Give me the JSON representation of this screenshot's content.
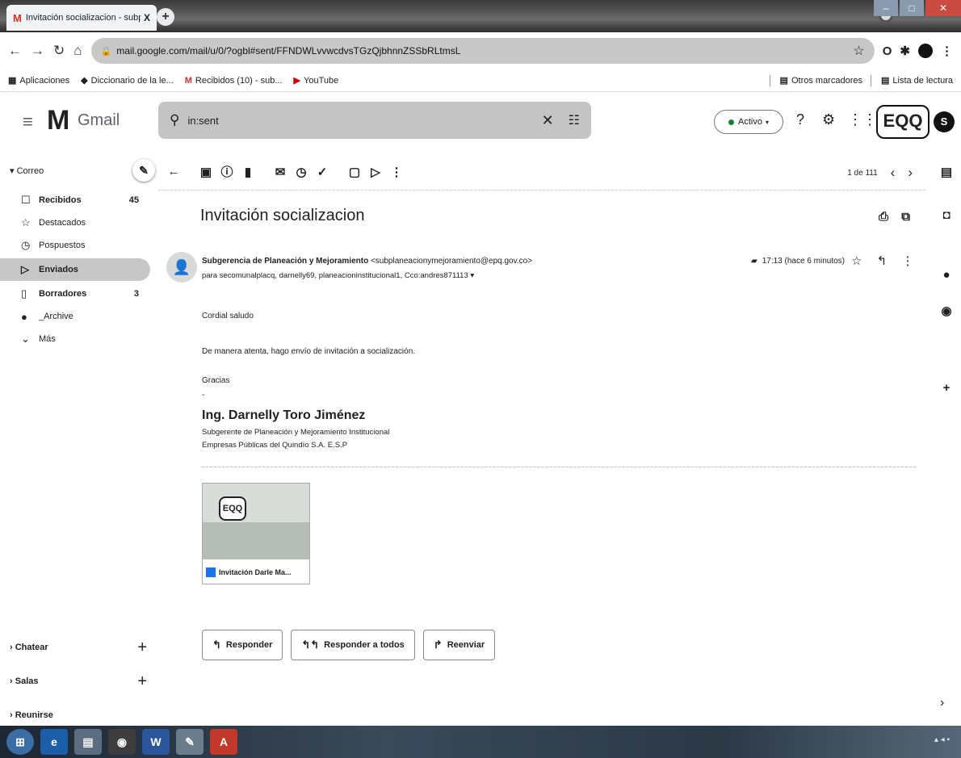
{
  "browser": {
    "tab_title": "Invitación socializacion - subplan",
    "tab_close": "X",
    "new_tab": "+",
    "url": "mail.google.com/mail/u/0/?ogbl#sent/FFNDWLvvwcdvsTGzQjbhnnZSSbRLtmsL",
    "bookmarks": [
      "Aplicaciones",
      "Diccionario de la le...",
      "Recibidos (10) - sub...",
      "YouTube"
    ],
    "bookmarks_right": [
      "Otros marcadores",
      "Lista de lectura"
    ]
  },
  "header": {
    "app_name": "Gmail",
    "search_value": "in:sent",
    "status": "Activo",
    "brand_badge": "EQQ",
    "avatar_letter": "S"
  },
  "sidebar": {
    "section_label": "Correo",
    "items": [
      {
        "icon": "inbox-icon",
        "glyph": "☐",
        "label": "Recibidos",
        "count": "45",
        "bold": true
      },
      {
        "icon": "star-icon",
        "glyph": "☆",
        "label": "Destacados",
        "count": "",
        "bold": false
      },
      {
        "icon": "clock-icon",
        "glyph": "◷",
        "label": "Pospuestos",
        "count": "",
        "bold": false
      },
      {
        "icon": "send-icon",
        "glyph": "▷",
        "label": "Enviados",
        "count": "",
        "bold": true
      },
      {
        "icon": "draft-icon",
        "glyph": "▯",
        "label": "Borradores",
        "count": "3",
        "bold": true
      },
      {
        "icon": "label-icon",
        "glyph": "●",
        "label": "_Archive",
        "count": "",
        "bold": false
      },
      {
        "icon": "chevron-down-icon",
        "glyph": "⌄",
        "label": "Más",
        "count": "",
        "bold": false
      }
    ],
    "bottom_sections": [
      "Chatear",
      "Salas",
      "Reunirse"
    ],
    "add_symbol": "+"
  },
  "toolbar": {
    "pager_text": "1 de 111"
  },
  "message": {
    "subject": "Invitación socializacion",
    "sender_name": "Subgerencia de Planeación y Mejoramiento",
    "sender_email": "<subplaneacionymejoramiento@epq.gov.co>",
    "recipients": "para secomunalplacq, darnelly69, planeacioninstitucional1, Cco:andres871113",
    "time": "17:13 (hace 6 minutos)",
    "greeting": "Cordial saludo",
    "body": "De manera atenta, hago envío de invitación a socialización.",
    "thanks": "Gracias",
    "sig_dash": "-",
    "signature_name": "Ing. Darnelly Toro Jiménez",
    "signature_title": "Subgerente de Planeación y Mejoramiento Institucional",
    "signature_company": "Empresas Públicas del Quindío S.A. E.S.P",
    "attachment_name": "Invitación Darle Ma...",
    "attachment_logo": "EQQ"
  },
  "actions": {
    "reply": "Responder",
    "reply_all": "Responder a todos",
    "forward": "Reenviar"
  },
  "colors": {
    "active_nav": "#c7c7c7",
    "search_bg": "#c4c4c4",
    "status_green": "#1a7f37",
    "gmail_red": "#d93025"
  }
}
